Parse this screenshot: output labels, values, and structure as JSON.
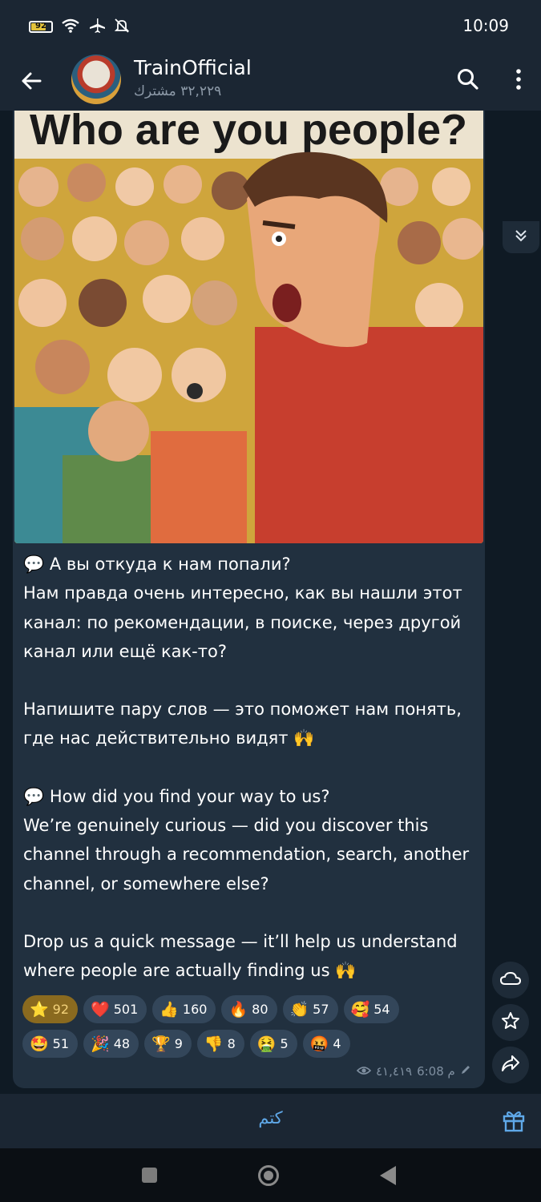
{
  "status_bar": {
    "battery_level": "92",
    "time": "10:09",
    "icons": [
      "battery-icon",
      "wifi-icon",
      "airplane-icon",
      "bell-off-icon"
    ]
  },
  "header": {
    "channel_name": "TrainOfficial",
    "subscribers": "٣٢,٢٢٩ مشترك",
    "icons": [
      "back-arrow-icon",
      "search-icon",
      "more-vertical-icon"
    ]
  },
  "photo": {
    "caption": "Who are you people?"
  },
  "message": {
    "ru_q": "А вы откуда к нам попали?",
    "ru_body": "Нам правда очень интересно, как вы нашли этот канал: по рекомендации, в поиске, через другой канал или ещё как-то?",
    "ru_cta": "Напишите пару слов — это поможет нам понять, где нас действительно видят",
    "en_q": "How did you find your way to us?",
    "en_body": "We’re genuinely curious — did you discover this channel through a recommendation, search, another channel, or somewhere else?",
    "en_cta": "Drop us a quick message — it’ll help us understand where people are actually finding us",
    "speech_emoji": "💬",
    "hands_emoji": "🙌"
  },
  "reactions": {
    "row1": [
      {
        "emoji": "⭐",
        "count": "92",
        "selected": true
      },
      {
        "emoji": "❤️",
        "count": "501"
      },
      {
        "emoji": "👍",
        "count": "160"
      },
      {
        "emoji": "🔥",
        "count": "80"
      },
      {
        "emoji": "👏",
        "count": "57"
      },
      {
        "emoji": "🥰",
        "count": "54"
      }
    ],
    "row2": [
      {
        "emoji": "🤩",
        "count": "51"
      },
      {
        "emoji": "🎉",
        "count": "48"
      },
      {
        "emoji": "🏆",
        "count": "9"
      },
      {
        "emoji": "👎",
        "count": "8"
      },
      {
        "emoji": "🤮",
        "count": "5"
      },
      {
        "emoji": "🤬",
        "count": "4"
      }
    ]
  },
  "meta": {
    "views": "٤١,٤١٩",
    "time": "6:08 م"
  },
  "side_buttons": [
    "cloud-icon",
    "star-icon",
    "share-icon"
  ],
  "bottom": {
    "mute_label": "كتم"
  },
  "colors": {
    "header_bg": "#1b2633",
    "bubble_bg": "#21303f",
    "accent": "#5fa8e8",
    "selected_reaction": "#8a6a1f"
  }
}
